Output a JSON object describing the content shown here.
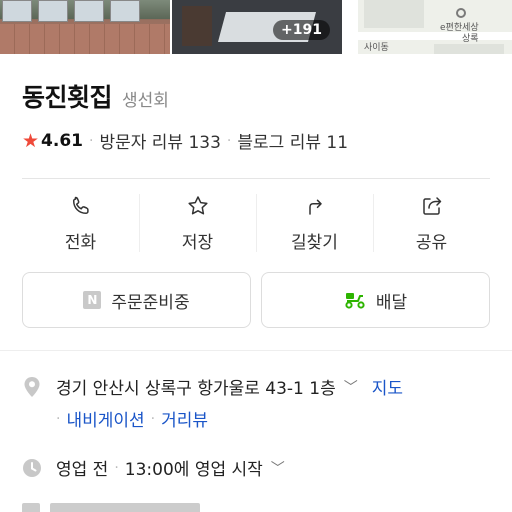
{
  "photos": {
    "more_count": "+191",
    "map_labels": [
      "e편한세상",
      "상록",
      "사이동"
    ]
  },
  "place": {
    "name": "동진횟집",
    "category": "생선회"
  },
  "rating": {
    "score": "4.61",
    "visitor_reviews": "방문자 리뷰 133",
    "blog_reviews": "블로그 리뷰 11"
  },
  "actions": [
    {
      "label": "전화",
      "icon": "phone-icon"
    },
    {
      "label": "저장",
      "icon": "star-outline-icon"
    },
    {
      "label": "길찾기",
      "icon": "directions-icon"
    },
    {
      "label": "공유",
      "icon": "share-icon"
    }
  ],
  "buttons": {
    "order": "주문준비중",
    "order_badge": "N",
    "delivery": "배달"
  },
  "address": {
    "text": "경기 안산시 상록구 항가울로 43-1 1층",
    "map_link": "지도",
    "navigation": "내비게이션",
    "street_view": "거리뷰"
  },
  "hours": {
    "status": "영업 전",
    "detail": "13:00에 영업 시작"
  },
  "colors": {
    "star": "#ef4a3a",
    "link": "#1a55c8",
    "delivery_green": "#2db400"
  }
}
